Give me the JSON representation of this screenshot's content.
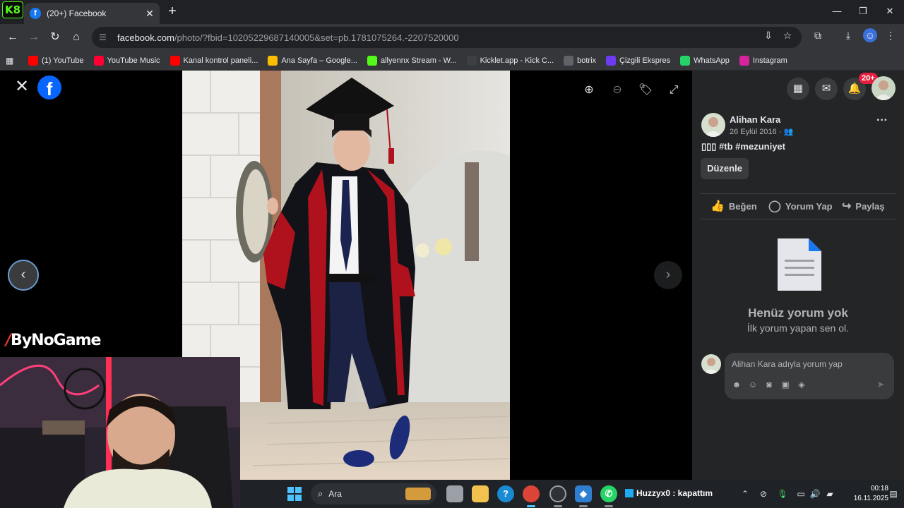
{
  "browser": {
    "kick_badge": "K8",
    "tab_title": "(20+) Facebook",
    "tab_favicon": "f",
    "url_host": "facebook.com",
    "url_path": "/photo/?fbid=10205229687140005&set=pb.1781075264.-2207520000",
    "bookmarks": [
      {
        "label": "(1) YouTube",
        "icon": "youtube-icon",
        "color": "#ff0000"
      },
      {
        "label": "YouTube Music",
        "icon": "youtube-music-icon",
        "color": "#ff0033"
      },
      {
        "label": "Kanal kontrol paneli...",
        "icon": "youtube-studio-icon",
        "color": "#ff0000"
      },
      {
        "label": "Ana Sayfa – Google...",
        "icon": "google-drive-icon",
        "color": "#fbbc04"
      },
      {
        "label": "allyennx Stream - W...",
        "icon": "kick-icon",
        "color": "#53fc18"
      },
      {
        "label": "Kicklet.app - Kick C...",
        "icon": "kicklet-icon",
        "color": "#3c4043"
      },
      {
        "label": "botrix",
        "icon": "botrix-icon",
        "color": "#5f6368"
      },
      {
        "label": "Çizgili Ekspres",
        "icon": "cizgili-icon",
        "color": "#6e3cf0"
      },
      {
        "label": "WhatsApp",
        "icon": "whatsapp-icon",
        "color": "#25d366"
      },
      {
        "label": "Instagram",
        "icon": "instagram-icon",
        "color": "#d6249f"
      }
    ]
  },
  "overlay": {
    "brand_mark": "/",
    "brand_text": "ByNoGame"
  },
  "panel": {
    "notif_count": "20+",
    "post": {
      "author": "Alihan Kara",
      "date": "26 Eylül 2016 · ",
      "caption": "▯▯▯ #tb #mezuniyet",
      "edit_label": "Düzenle"
    },
    "actions": {
      "like": "Beğen",
      "comment": "Yorum Yap",
      "share": "Paylaş"
    },
    "empty_title": "Henüz yorum yok",
    "empty_sub": "İlk yorum yapan sen ol.",
    "comment_placeholder": "Alihan Kara adıyla yorum yap"
  },
  "taskbar": {
    "search_label": "Ara",
    "notice": "Huzzyx0 : kapattım",
    "time": "00:18",
    "date": "16.11.2025"
  },
  "colors": {
    "facebook_blue": "#0866ff",
    "panel_bg": "#242526",
    "badge_red": "#e41e3f"
  }
}
